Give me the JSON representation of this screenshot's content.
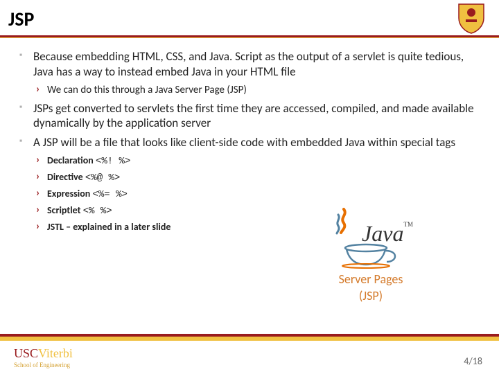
{
  "header": {
    "title": "JSP"
  },
  "bullets": {
    "b1": "Because embedding HTML, CSS, and Java. Script as the output of a servlet is quite tedious, Java has a way to instead embed Java in your HTML file",
    "b1s1": "We can do this through a Java Server Page (JSP)",
    "b2": "JSPs get converted to servlets the first time they are accessed, compiled, and made available dynamically by the application server",
    "b3": "A JSP will be a file that looks like client-side code with embedded Java within special tags",
    "b3s1": "Declaration",
    "b3s1c": "<%! %>",
    "b3s2": "Directive",
    "b3s2c": "<%@ %>",
    "b3s3": "Expression",
    "b3s3c": "<%= %>",
    "b3s4": "Scriptlet",
    "b3s4c": "<% %>",
    "b3s5": "JSTL – explained in a later slide"
  },
  "javalogo": {
    "java": "Java",
    "tm": "TM",
    "line1": "Server Pages",
    "line2": "(JSP)"
  },
  "footer": {
    "usc": "USC",
    "viterbi": "Viterbi",
    "school": "School of Engineering",
    "page": "4/18"
  }
}
